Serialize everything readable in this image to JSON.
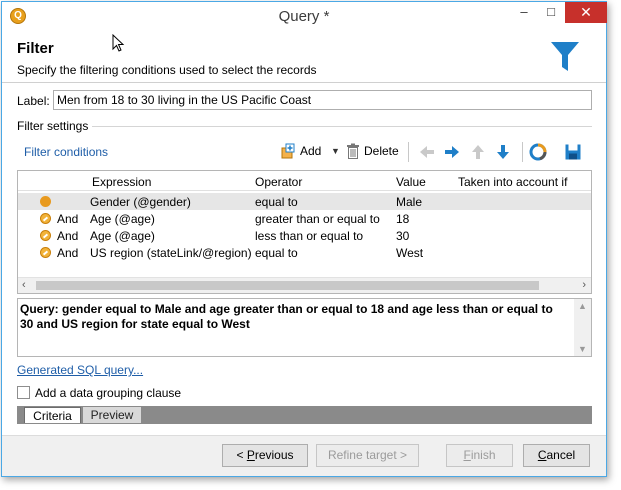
{
  "window": {
    "title": "Query *"
  },
  "header": {
    "title": "Filter",
    "subtitle": "Specify the filtering conditions used to select the records"
  },
  "label_field": {
    "label": "Label:",
    "value": "Men from 18 to 30 living in the US Pacific Coast"
  },
  "filter_settings": {
    "section_title": "Filter settings",
    "link": "Filter conditions",
    "add_label": "Add",
    "delete_label": "Delete"
  },
  "grid": {
    "columns": [
      "Expression",
      "Operator",
      "Value",
      "Taken into account if"
    ],
    "rows": [
      {
        "logic": "",
        "expression": "Gender (@gender)",
        "operator": "equal to",
        "value": "Male",
        "taken": ""
      },
      {
        "logic": "And",
        "expression": "Age (@age)",
        "operator": "greater than or equal to",
        "value": "18",
        "taken": ""
      },
      {
        "logic": "And",
        "expression": "Age (@age)",
        "operator": "less than or equal to",
        "value": "30",
        "taken": ""
      },
      {
        "logic": "And",
        "expression": "US region (stateLink/@region)",
        "operator": "equal to",
        "value": "West",
        "taken": ""
      }
    ]
  },
  "query_summary": "Query: gender equal to Male and age greater than or equal to 18 and age less than or equal to 30 and US region for state equal to West",
  "sql_link": "Generated SQL query...",
  "grouping": {
    "label": "Add a data grouping clause",
    "checked": false
  },
  "tabs": [
    "Criteria",
    "Preview"
  ],
  "footer": {
    "previous_pre": "< ",
    "previous_key": "P",
    "previous_rest": "revious",
    "refine": "Refine target >",
    "finish_key": "F",
    "finish_rest": "inish",
    "cancel_key": "C",
    "cancel_rest": "ancel"
  },
  "colors": {
    "accent": "#1f7fc8",
    "link": "#1f5ea8",
    "close_button": "#c7302b",
    "condition_icon": "#e89a1f",
    "tab_bar": "#8a8a8a"
  },
  "icons": {
    "app": "app-icon",
    "funnel": "filter-funnel-icon",
    "add": "add-icon",
    "delete": "trash-icon",
    "nav": [
      "arrow-left-icon",
      "arrow-right-icon",
      "arrow-up-icon",
      "arrow-down-icon"
    ],
    "chart": "pie-chart-icon",
    "save": "save-icon"
  }
}
